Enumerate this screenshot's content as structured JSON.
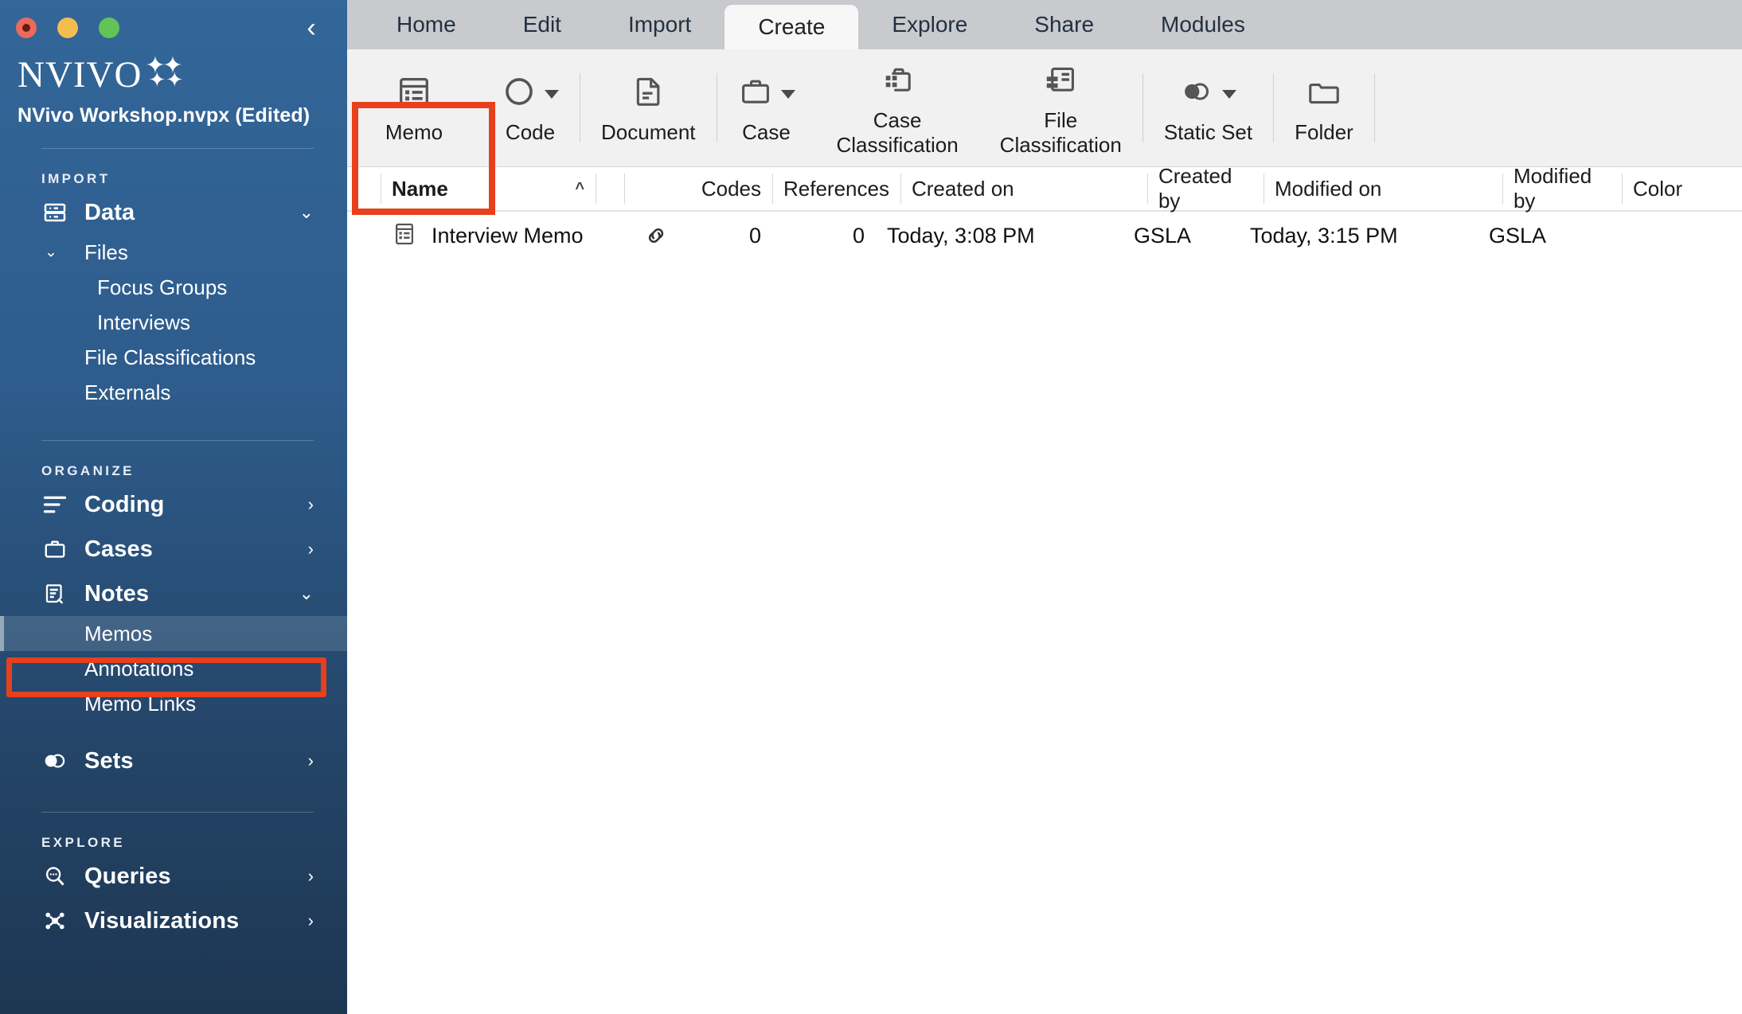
{
  "window": {
    "traffic_lights": [
      "close",
      "minimize",
      "maximize"
    ],
    "collapse_icon": "chevron-left-icon"
  },
  "sidebar": {
    "logo_text": "NVIVO",
    "project_name": "NVivo Workshop.nvpx (Edited)",
    "sections": [
      {
        "label": "IMPORT",
        "items": [
          {
            "label": "Data",
            "icon": "data-drawer-icon",
            "chevron": "chevron-down",
            "level": 1
          },
          {
            "label": "Files",
            "icon": "",
            "chevron": "chevron-down-small",
            "level": 2
          },
          {
            "label": "Focus Groups",
            "icon": "",
            "level": 3
          },
          {
            "label": "Interviews",
            "icon": "",
            "level": 3
          },
          {
            "label": "File Classifications",
            "icon": "",
            "level": 2
          },
          {
            "label": "Externals",
            "icon": "",
            "level": 2
          }
        ]
      },
      {
        "label": "ORGANIZE",
        "items": [
          {
            "label": "Coding",
            "icon": "coding-lines-icon",
            "chevron": "chevron-right",
            "level": 1
          },
          {
            "label": "Cases",
            "icon": "briefcase-icon",
            "chevron": "chevron-right",
            "level": 1
          },
          {
            "label": "Notes",
            "icon": "notes-icon",
            "chevron": "chevron-down",
            "level": 1
          },
          {
            "label": "Memos",
            "icon": "",
            "level": 2,
            "selected": true,
            "highlighted": true
          },
          {
            "label": "Annotations",
            "icon": "",
            "level": 2
          },
          {
            "label": "Memo Links",
            "icon": "",
            "level": 2
          },
          {
            "label": "Sets",
            "icon": "sets-venn-icon",
            "chevron": "chevron-right",
            "level": 1
          }
        ]
      },
      {
        "label": "EXPLORE",
        "items": [
          {
            "label": "Queries",
            "icon": "query-search-icon",
            "chevron": "chevron-right",
            "level": 1
          },
          {
            "label": "Visualizations",
            "icon": "visualizations-icon",
            "chevron": "chevron-right",
            "level": 1
          }
        ]
      }
    ]
  },
  "ribbon": {
    "tabs": [
      {
        "label": "Home",
        "active": false
      },
      {
        "label": "Edit",
        "active": false
      },
      {
        "label": "Import",
        "active": false
      },
      {
        "label": "Create",
        "active": true
      },
      {
        "label": "Explore",
        "active": false
      },
      {
        "label": "Share",
        "active": false
      },
      {
        "label": "Modules",
        "active": false
      }
    ],
    "buttons": [
      {
        "label": "Memo",
        "icon": "memo-icon",
        "dropdown": false,
        "highlighted": true
      },
      {
        "label": "Code",
        "icon": "circle-code-icon",
        "dropdown": true
      },
      {
        "label": "Document",
        "icon": "document-icon",
        "dropdown": false,
        "separator_before": true
      },
      {
        "label": "Case",
        "icon": "case-briefcase-icon",
        "dropdown": true,
        "separator_before": true
      },
      {
        "label": "Case\nClassification",
        "icon": "case-classification-icon",
        "dropdown": false
      },
      {
        "label": "File\nClassification",
        "icon": "file-classification-icon",
        "dropdown": false
      },
      {
        "label": "Static Set",
        "icon": "static-set-icon",
        "dropdown": true,
        "separator_before": true
      },
      {
        "label": "Folder",
        "icon": "folder-icon",
        "dropdown": false,
        "separator_before": true
      }
    ]
  },
  "table": {
    "columns": [
      {
        "key": "name",
        "label": "Name",
        "sorted": "asc",
        "bold": true
      },
      {
        "key": "link",
        "label": ""
      },
      {
        "key": "codes",
        "label": "Codes"
      },
      {
        "key": "references",
        "label": "References"
      },
      {
        "key": "created_on",
        "label": "Created on"
      },
      {
        "key": "created_by",
        "label": "Created by"
      },
      {
        "key": "modified_on",
        "label": "Modified on"
      },
      {
        "key": "modified_by",
        "label": "Modified by"
      },
      {
        "key": "color",
        "label": "Color"
      }
    ],
    "rows": [
      {
        "icon": "memo-row-icon",
        "name": "Interview Memo",
        "link_icon": "link-icon",
        "codes": "0",
        "references": "0",
        "created_on": "Today, 3:08 PM",
        "created_by": "GSLA",
        "modified_on": "Today, 3:15 PM",
        "modified_by": "GSLA",
        "color": ""
      }
    ]
  },
  "colors": {
    "sidebar_top": "#336699",
    "sidebar_bottom": "#1d3652",
    "highlight_red": "#E8401C",
    "tabbar_gray": "#C8CACD",
    "ribbon_gray": "#F1F1F1"
  }
}
